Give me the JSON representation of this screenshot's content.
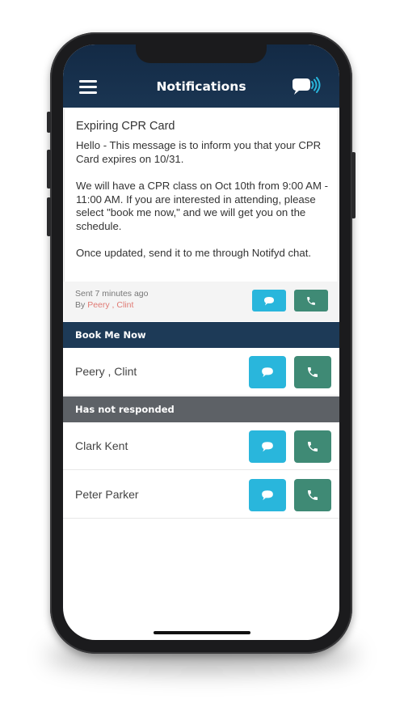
{
  "header": {
    "title": "Notifications",
    "menu_icon": "hamburger-menu-icon",
    "logo_icon": "notifyd-chat-logo-icon"
  },
  "message": {
    "title": "Expiring CPR Card",
    "paragraphs": [
      "Hello - This message is to inform you that your CPR Card expires on 10/31.",
      "We will have a CPR class on Oct 10th from 9:00 AM - 11:00 AM. If you are interested in attending, please select \"book me now,\" and we will get you on the schedule.",
      "Once updated, send it to me through Notifyd chat."
    ],
    "sent": "Sent 7 minutes ago",
    "by_prefix": "By",
    "by_names": "Peery , Clint"
  },
  "sections": {
    "book_me_now": {
      "label": "Book Me Now",
      "people": [
        "Peery , Clint"
      ]
    },
    "not_responded": {
      "label": "Has not responded",
      "people": [
        "Clark Kent",
        "Peter Parker"
      ]
    }
  },
  "colors": {
    "header_bg": "#132a45",
    "book_section_bg": "#1d3a57",
    "pending_section_bg": "#5d6166",
    "chat_button": "#29b6dc",
    "call_button": "#3f8a75",
    "sender_name": "#e07a74"
  },
  "icons": {
    "chat": "chat-bubble-icon",
    "call": "phone-icon"
  }
}
